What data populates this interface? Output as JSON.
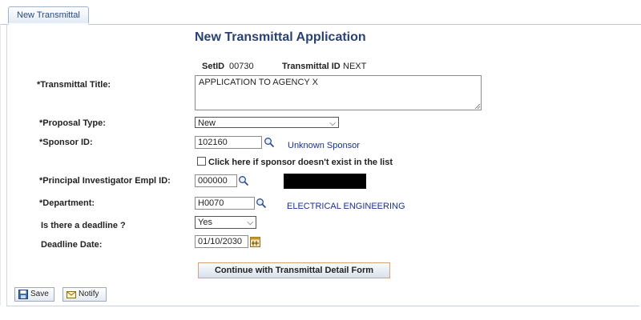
{
  "tabs": [
    {
      "label": "New Transmittal"
    }
  ],
  "page": {
    "title": "New Transmittal Application"
  },
  "header": {
    "setid_label": "SetID",
    "setid_value": "00730",
    "transmittal_id_label": "Transmittal ID",
    "transmittal_id_value": "NEXT"
  },
  "form": {
    "transmittal_title": {
      "label": "*Transmittal Title:",
      "value": "APPLICATION TO AGENCY X"
    },
    "proposal_type": {
      "label": "*Proposal Type:",
      "value": "New"
    },
    "sponsor_id": {
      "label": "*Sponsor ID:",
      "value": "102160",
      "description": "Unknown Sponsor"
    },
    "sponsor_not_listed": {
      "label": "Click here if sponsor doesn't exist in the list",
      "checked": false
    },
    "pi_empl_id": {
      "label": "*Principal Investigator Empl ID:",
      "value": "000000"
    },
    "department": {
      "label": "*Department:",
      "value": "H0070",
      "description": "ELECTRICAL ENGINEERING"
    },
    "deadline": {
      "label": "Is there a deadline ?",
      "value": "Yes"
    },
    "deadline_date": {
      "label": "Deadline Date:",
      "value": "01/10/2030"
    }
  },
  "buttons": {
    "continue": "Continue with Transmittal Detail Form",
    "save": "Save",
    "notify": "Notify"
  },
  "icons": {
    "lookup": "magnifier-icon",
    "calendar": "calendar-icon",
    "save": "save-icon",
    "notify": "notify-icon"
  },
  "colors": {
    "title": "#2b4170",
    "link_text": "#1a2f9a",
    "continue_border": "#d6a470"
  }
}
